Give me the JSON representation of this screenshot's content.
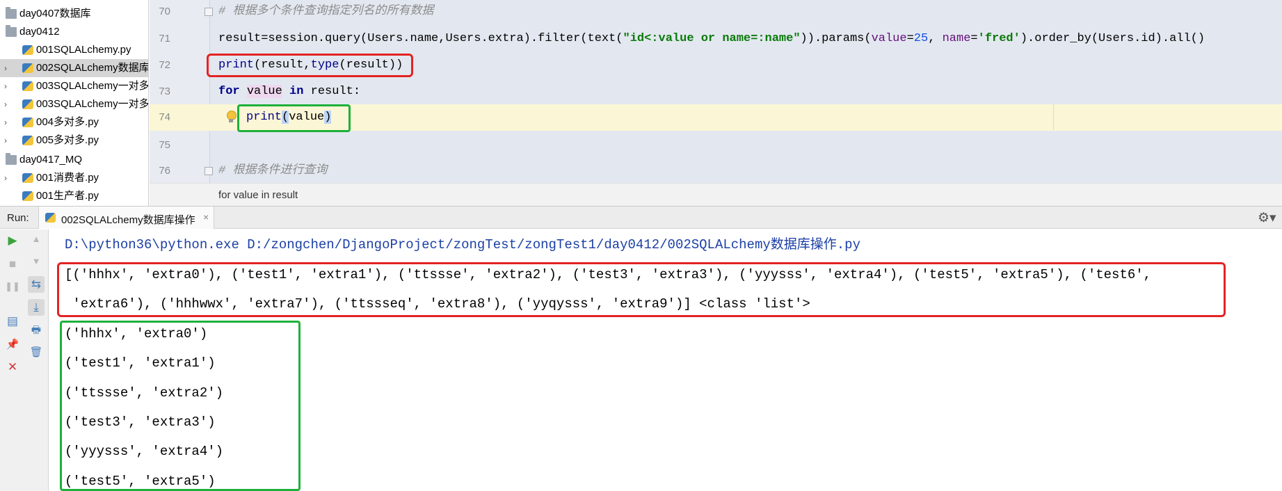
{
  "project_tree": {
    "items": [
      {
        "label": "day0407数据库",
        "icon": "folder-icon",
        "expand_arrow": ""
      },
      {
        "label": "day0412",
        "icon": "folder-icon",
        "expand_arrow": ""
      },
      {
        "label": "001SQLALchemy.py",
        "icon": "python-file-icon",
        "expand_arrow": ""
      },
      {
        "label": "002SQLALchemy数据库",
        "icon": "python-file-icon",
        "expand_arrow": "›"
      },
      {
        "label": "003SQLALchemy一对多",
        "icon": "python-file-icon",
        "expand_arrow": "›"
      },
      {
        "label": "003SQLALchemy一对多",
        "icon": "python-file-icon",
        "expand_arrow": "›"
      },
      {
        "label": "004多对多.py",
        "icon": "python-file-icon",
        "expand_arrow": "›"
      },
      {
        "label": "005多对多.py",
        "icon": "python-file-icon",
        "expand_arrow": "›"
      },
      {
        "label": "day0417_MQ",
        "icon": "folder-icon",
        "expand_arrow": ""
      },
      {
        "label": "001消费者.py",
        "icon": "python-file-icon",
        "expand_arrow": "›"
      },
      {
        "label": "001生产者.py",
        "icon": "python-file-icon",
        "expand_arrow": ""
      }
    ],
    "selected_index": 3
  },
  "editor": {
    "line_numbers": [
      "70",
      "71",
      "72",
      "73",
      "74",
      "75",
      "76"
    ],
    "line70_comment": "# 根据多个条件查询指定列名的所有数据",
    "line71": {
      "p1": "result=session.query(Users.name,Users.extra).filter(text(",
      "str": "\"id<:value or name=:name\"",
      "p2": ")).params(",
      "kw1": "value",
      "p3": "=",
      "num": "25",
      "p4": ", ",
      "kw2": "name",
      "p5": "=",
      "str2": "'fred'",
      "p6": ").order_by(Users.id).all()"
    },
    "line72": {
      "fn1": "print",
      "a": "(result,",
      "fn2": "type",
      "b": "(result))"
    },
    "line73": {
      "kw_for": "for",
      "var": "value",
      "kw_in": "in",
      "rest": "result:"
    },
    "line74": {
      "fn": "print",
      "open": "(",
      "arg": "value",
      "close": ")"
    },
    "line76_comment": "# 根据条件进行查询",
    "breadcrumb": "for value in result"
  },
  "run": {
    "label": "Run:",
    "tab_label": "002SQLALchemy数据库操作",
    "tab_close": "×",
    "settings_icon": "⚙▾",
    "output": {
      "command": "D:\\python36\\python.exe D:/zongchen/DjangoProject/zongTest/zongTest1/day0412/002SQLALchemy数据库操作.py",
      "list_line1": "[('hhhx', 'extra0'), ('test1', 'extra1'), ('ttssse', 'extra2'), ('test3', 'extra3'), ('yyysss', 'extra4'), ('test5', 'extra5'), ('test6',",
      "list_line2": " 'extra6'), ('hhhwwx', 'extra7'), ('ttssseq', 'extra8'), ('yyqysss', 'extra9')] <class 'list'>",
      "rows": [
        "('hhhx', 'extra0')",
        "('test1', 'extra1')",
        "('ttssse', 'extra2')",
        "('test3', 'extra3')",
        "('yyysss', 'extra4')",
        "('test5', 'extra5')"
      ]
    },
    "toolbar": {
      "rerun": "▶",
      "stop": "■",
      "pause": "❚❚",
      "layout": "▤",
      "pin": "📌",
      "close": "✕",
      "up": "▲",
      "down": "▼",
      "soft_wrap": "⇆",
      "scroll_end": "⤓",
      "print": "🖶",
      "clear": "🗑"
    }
  },
  "colors": {
    "annotation_red": "#e32323",
    "annotation_green": "#1db13a",
    "keyword": "#00008b",
    "string": "#0a7a0a",
    "number": "#1750eb"
  }
}
